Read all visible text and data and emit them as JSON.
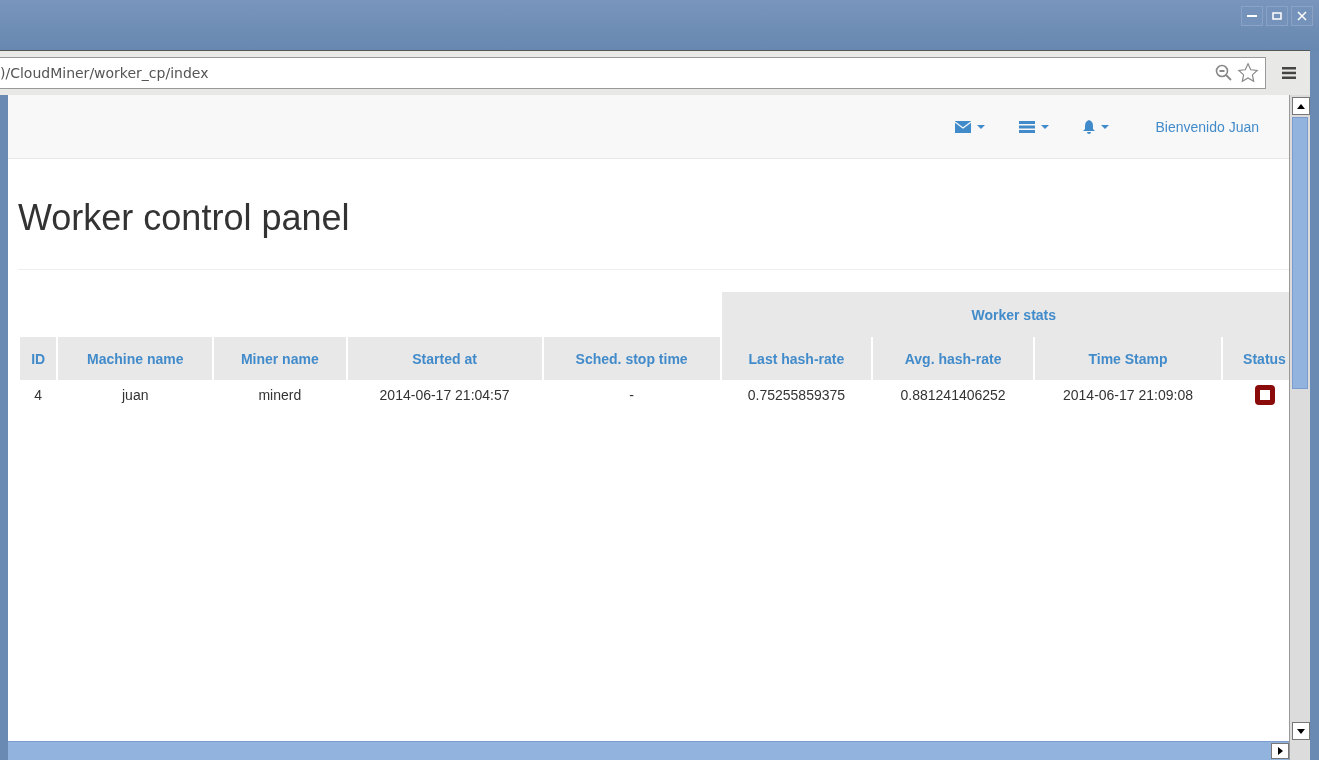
{
  "browser": {
    "address": ")/CloudMiner/worker_cp/index"
  },
  "navbar": {
    "user_link": "Bienvenido Juan"
  },
  "page": {
    "title": "Worker control panel"
  },
  "table": {
    "group_header": "Worker stats",
    "columns": [
      "ID",
      "Machine name",
      "Miner name",
      "Started at",
      "Sched. stop time",
      "Last hash-rate",
      "Avg. hash-rate",
      "Time Stamp",
      "Status"
    ],
    "rows": [
      {
        "cells": [
          "4",
          "juan",
          "minerd",
          "2014-06-17 21:04:57",
          "-",
          "0.75255859375",
          "0.881241406252",
          "2014-06-17 21:09:08"
        ]
      }
    ]
  }
}
